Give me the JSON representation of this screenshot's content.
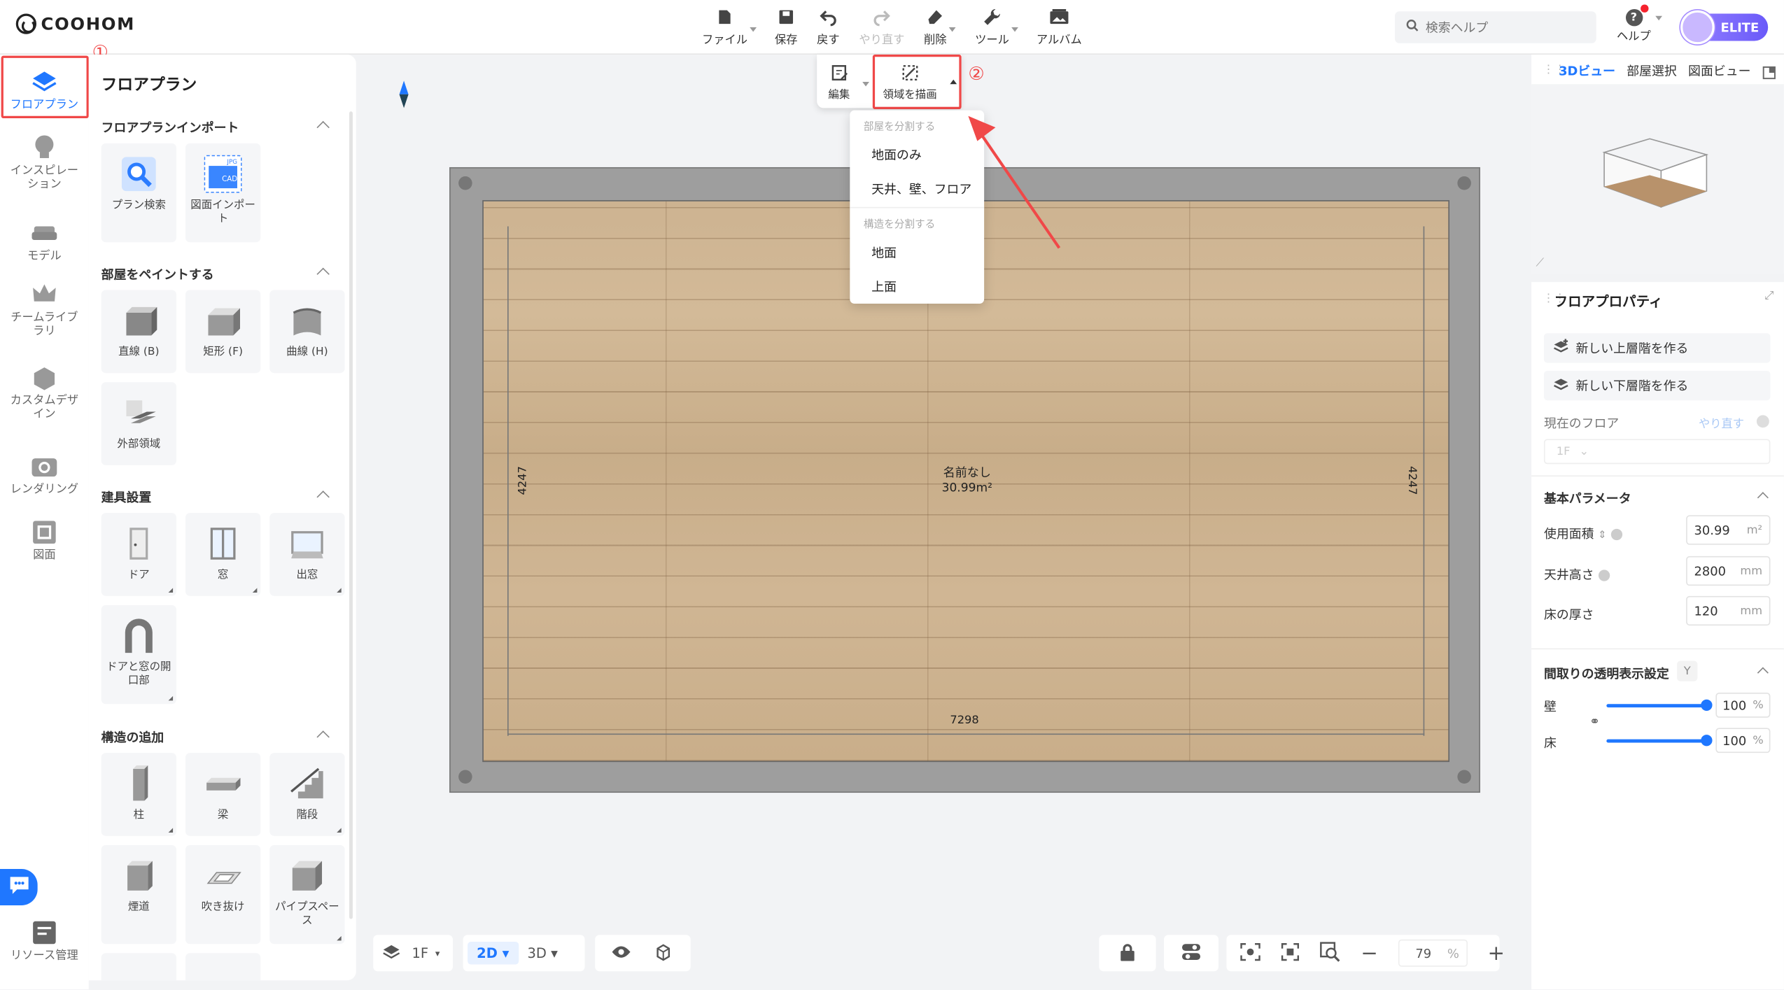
{
  "app": {
    "logo": "COOHOM"
  },
  "toolbar": {
    "file": "ファイル",
    "save": "保存",
    "undo": "戻す",
    "redo": "やり直す",
    "delete": "削除",
    "tools": "ツール",
    "album": "アルバム"
  },
  "search": {
    "placeholder": "検索ヘルプ"
  },
  "help": {
    "label": "ヘルプ"
  },
  "account": {
    "badge": "ELITE"
  },
  "nav": {
    "items": [
      {
        "label": "フロアプラン"
      },
      {
        "label": "インスピレーション"
      },
      {
        "label": "モデル"
      },
      {
        "label": "チームライブラリ"
      },
      {
        "label": "カスタムデザイン"
      },
      {
        "label": "レンダリング"
      },
      {
        "label": "図面"
      },
      {
        "label": "リソース管理"
      }
    ]
  },
  "annotations": {
    "one": "①",
    "two": "②"
  },
  "panel": {
    "title": "フロアプラン",
    "sections": [
      {
        "title": "フロアプランインポート",
        "items": [
          "プラン検索",
          "図面インポート"
        ]
      },
      {
        "title": "部屋をペイントする",
        "items": [
          "直線 (B)",
          "矩形 (F)",
          "曲線 (H)",
          "外部領域"
        ]
      },
      {
        "title": "建具設置",
        "items": [
          "ドア",
          "窓",
          "出窓",
          "ドアと窓の開口部"
        ]
      },
      {
        "title": "構造の追加",
        "items": [
          "柱",
          "梁",
          "階段",
          "煙道",
          "吹き抜け",
          "パイプスペース"
        ]
      }
    ],
    "import_badges": {
      "jpg": "JPG",
      "cad": "CAD"
    }
  },
  "floatbar": {
    "edit": "編集",
    "draw_area": "領域を描画"
  },
  "dropdown": {
    "room_header": "部屋を分割する",
    "floor_only": "地面のみ",
    "ceiling_wall_floor": "天井、壁、フロア",
    "structure_header": "構造を分割する",
    "ground": "地面",
    "top": "上面"
  },
  "room": {
    "name": "名前なし",
    "area": "30.99m²",
    "dim_left": "4247",
    "dim_right": "4247",
    "dim_bottom": "7298"
  },
  "bottombar": {
    "floor": "1F",
    "view2d": "2D",
    "view3d": "3D",
    "zoom": "79",
    "zoom_unit": "%"
  },
  "right": {
    "tabs": [
      "3Dビュー",
      "部屋選択",
      "図面ビュー"
    ],
    "props_title": "フロアプロパティ",
    "new_upper": "新しい上層階を作る",
    "new_lower": "新しい下層階を作る",
    "current_floor": "現在のフロア",
    "redo": "やり直す",
    "floor_value": "1F",
    "basic_params": "基本パラメータ",
    "usable_area": "使用面積",
    "usable_area_value": "30.99",
    "usable_area_unit": "m²",
    "ceiling_height": "天井高さ",
    "ceiling_height_value": "2800",
    "ceiling_height_unit": "mm",
    "floor_thickness": "床の厚さ",
    "floor_thickness_value": "120",
    "floor_thickness_unit": "mm",
    "transparency": "間取りの透明表示設定",
    "transparency_key": "Y",
    "wall": "壁",
    "wall_value": "100",
    "floor": "床",
    "floor_opacity_value": "100",
    "percent": "%",
    "wall_level": 1.0,
    "floor_level": 1.0
  },
  "colors": {
    "accent": "#1f77ff",
    "highlight": "#f04848",
    "elite": "#7b68f8"
  }
}
